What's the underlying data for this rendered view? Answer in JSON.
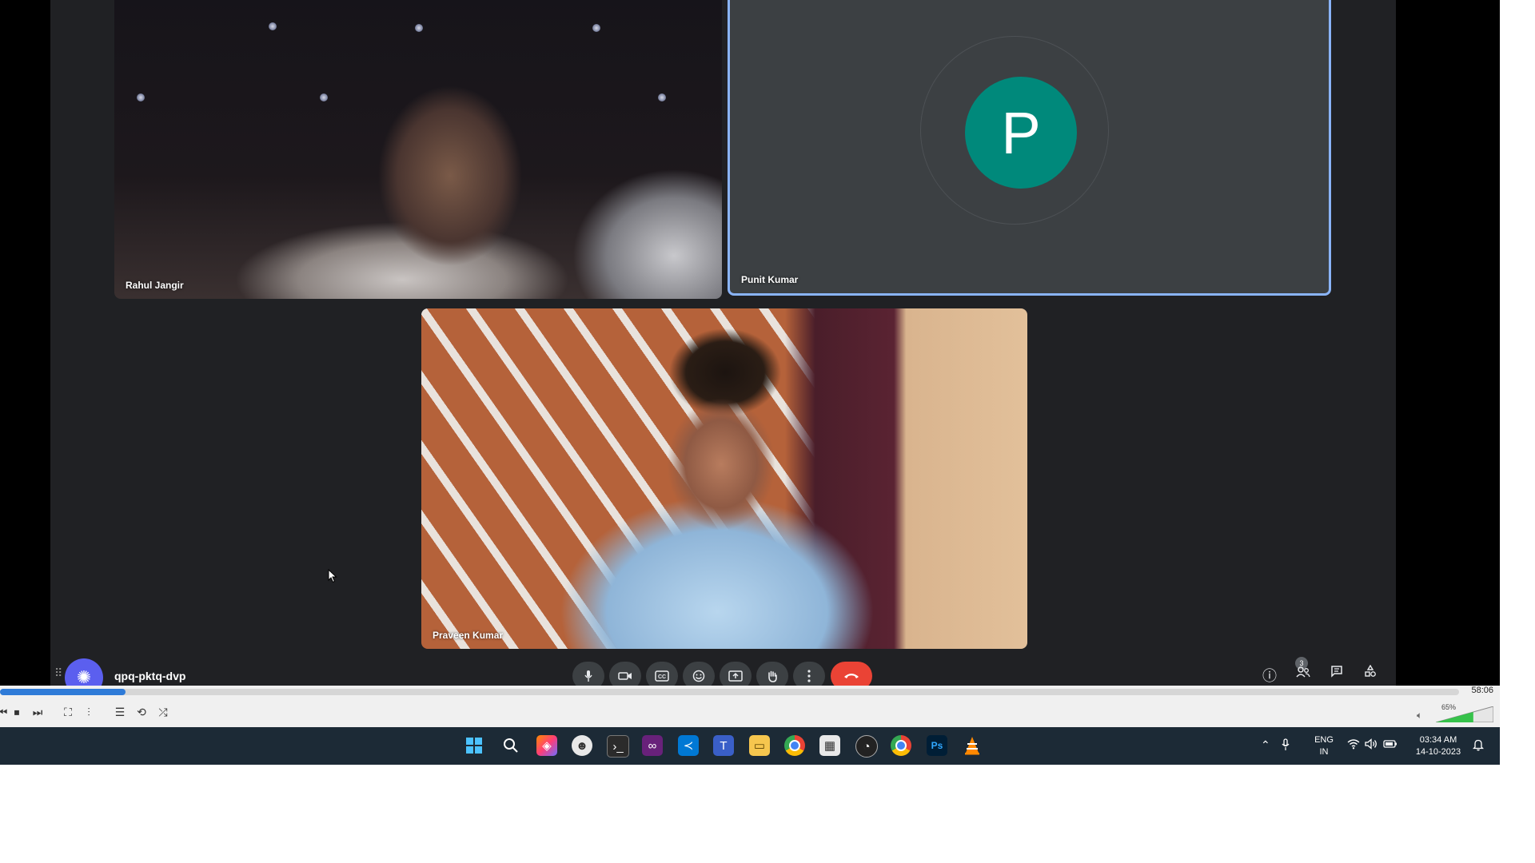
{
  "participants": {
    "rahul": {
      "name": "Rahul Jangir"
    },
    "punit": {
      "name": "Punit Kumar",
      "initial": "P"
    },
    "praveen": {
      "name": "Praveen Kumar"
    }
  },
  "meeting": {
    "code": "qpq-pktq-dvp",
    "people_count": "3",
    "icons": [
      "mic-icon",
      "camera-icon",
      "captions-icon",
      "emoji-icon",
      "present-icon",
      "raise-hand-icon",
      "more-options-icon",
      "end-call-icon",
      "info-icon",
      "people-icon",
      "chat-icon",
      "activities-icon"
    ]
  },
  "player": {
    "elapsed": "58:06",
    "progress": 0.086,
    "volume_percent": "65%",
    "volume": 0.65
  },
  "taskbar": {
    "language": "ENG",
    "region": "IN",
    "time": "03:34 AM",
    "date": "14-10-2023"
  },
  "colors": {
    "meet_bg": "#202124",
    "avatar": "#00897b",
    "end_call": "#ea4335",
    "speaking_border": "#8ab4f8",
    "fab": "#5b5fef"
  }
}
